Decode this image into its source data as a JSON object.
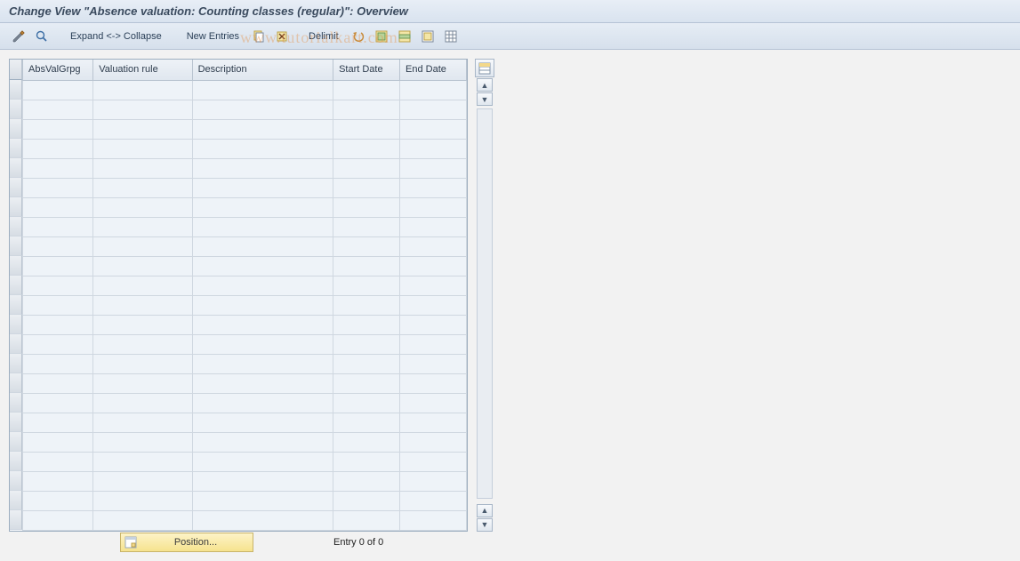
{
  "title": "Change View \"Absence valuation: Counting classes (regular)\": Overview",
  "toolbar": {
    "expand_collapse_label": "Expand <-> Collapse",
    "new_entries_label": "New Entries",
    "delimit_label": "Delimit"
  },
  "watermark": "www.tutorialkart.com",
  "table": {
    "columns": [
      "AbsValGrpg",
      "Valuation rule",
      "Description",
      "Start Date",
      "End Date"
    ],
    "row_count": 23
  },
  "footer": {
    "position_label": "Position...",
    "entry_status": "Entry 0 of 0"
  }
}
